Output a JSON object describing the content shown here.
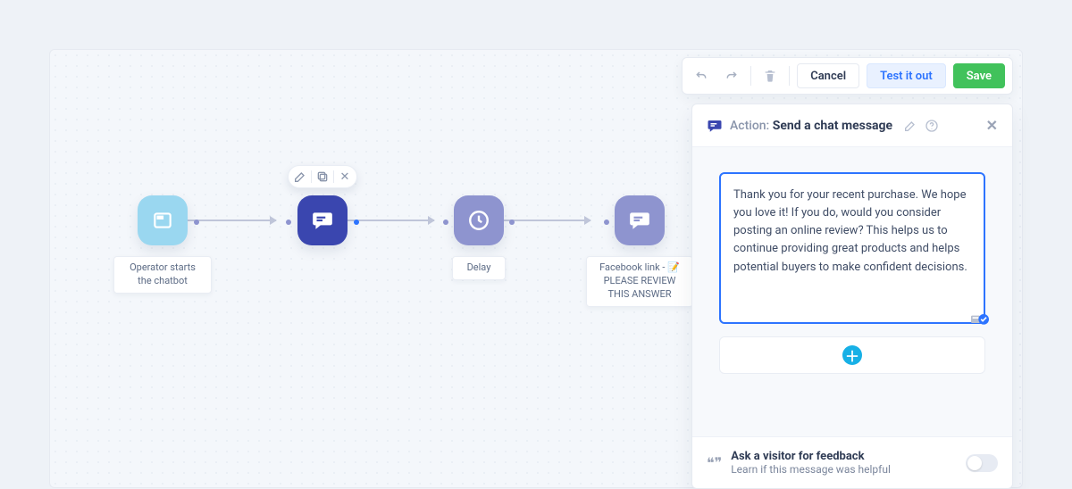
{
  "toolbar": {
    "cancel": "Cancel",
    "test": "Test it out",
    "save": "Save"
  },
  "panel": {
    "action_label": "Action:",
    "action_name": "Send a chat message",
    "message": "Thank you for your recent purchase. We hope you love it! If you do, would you consider posting an online review? This helps us to continue providing great products and helps potential buyers to make confident decisions.",
    "feedback_title": "Ask a visitor for feedback",
    "feedback_sub": "Learn if this message was helpful"
  },
  "nodes": {
    "start": "Operator starts the chatbot",
    "delay": "Delay",
    "fb": "Facebook link - 📝 PLEASE REVIEW THIS ANSWER"
  }
}
